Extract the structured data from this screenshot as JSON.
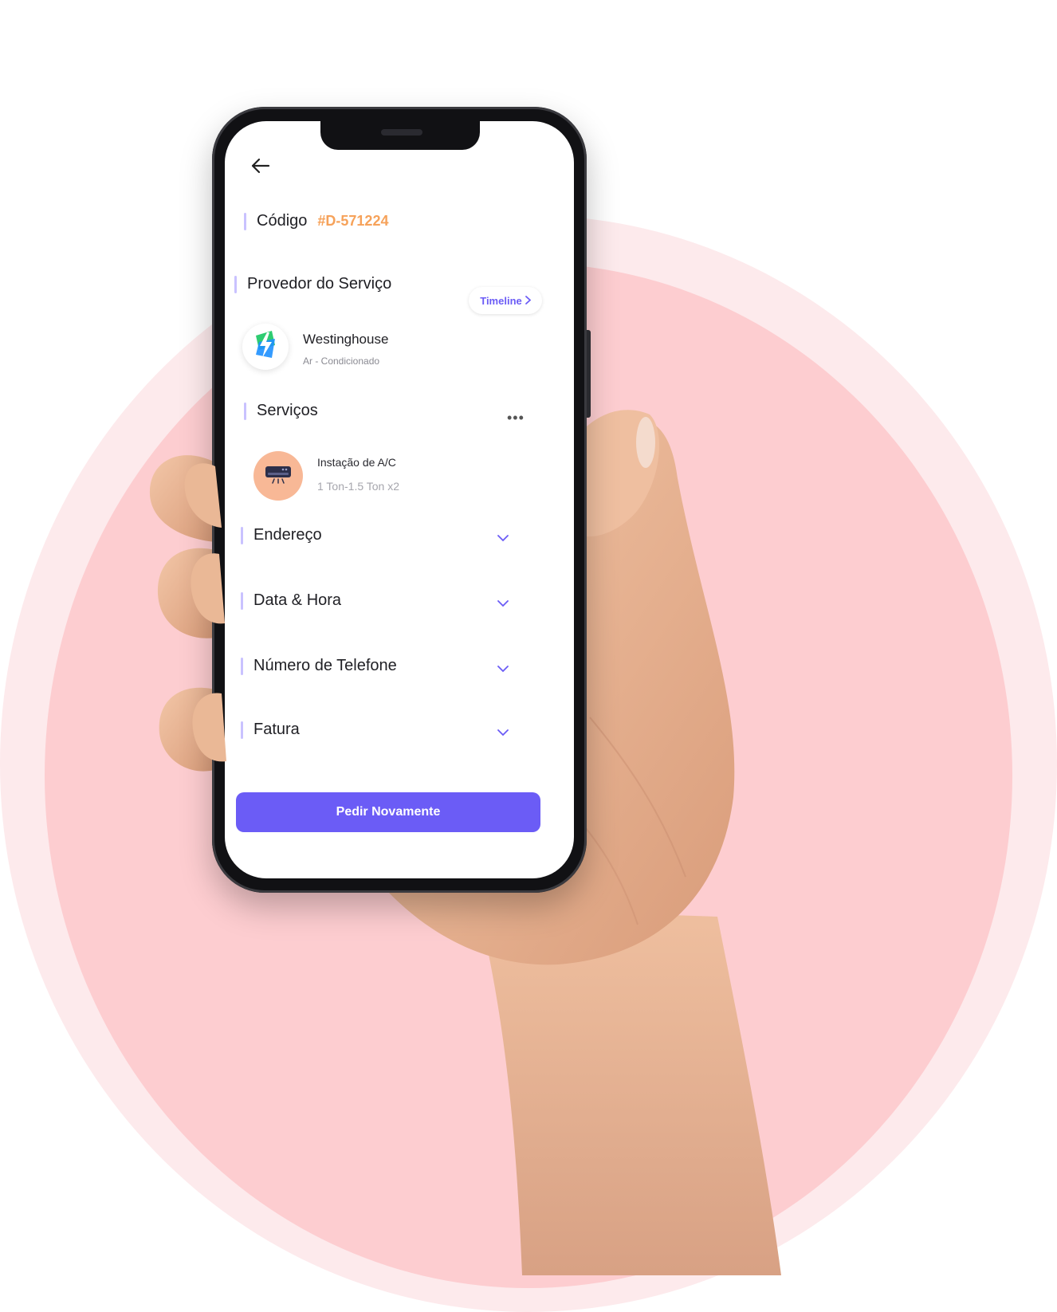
{
  "colors": {
    "accent": "#6b5cf6",
    "code_orange": "#f6a25a",
    "disc_pink": "#fdcdd0",
    "halo_pink": "#fdeaec",
    "service_icon_bg": "#f8b896",
    "section_bar": "#c9c2ff"
  },
  "order": {
    "code_label": "Código",
    "code_value": "#D-571224"
  },
  "provider": {
    "section_title": "Provedor do Serviço",
    "timeline_label": "Timeline",
    "name": "Westinghouse",
    "category": "Ar - Condicionado",
    "logo_icon": "lightning-bolt-icon"
  },
  "services": {
    "section_title": "Serviços",
    "more_icon": "more-dots-icon",
    "items": [
      {
        "name": "Instação de A/C",
        "detail": "1 Ton-1.5 Ton x2",
        "icon": "air-conditioner-icon"
      }
    ]
  },
  "accordions": [
    {
      "label": "Endereço",
      "icon": "chevron-down-icon"
    },
    {
      "label": "Data & Hora",
      "icon": "chevron-down-icon"
    },
    {
      "label": "Número de Telefone",
      "icon": "chevron-down-icon"
    },
    {
      "label": "Fatura",
      "icon": "chevron-down-icon"
    }
  ],
  "cta": {
    "label": "Pedir Novamente"
  }
}
